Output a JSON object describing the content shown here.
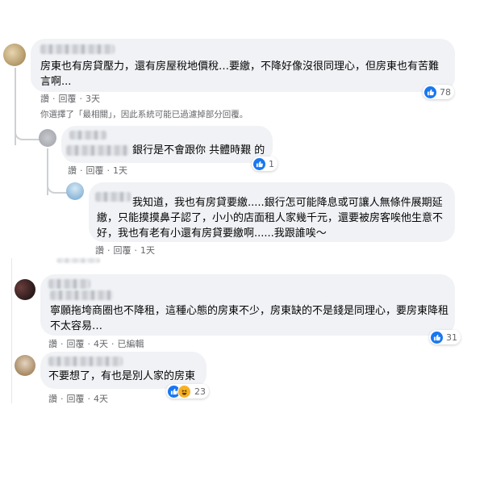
{
  "comments": [
    {
      "text": "房東也有房貸壓力，還有房屋稅地價稅…要繳，不降好像沒很同理心，但房東也有苦難言啊...",
      "actions": {
        "like": "讚",
        "reply": "回覆",
        "time": "3天"
      },
      "reaction_count": "78"
    },
    {
      "filter_note": "你選擇了「最相關」，因此系統可能已過濾掉部分回覆。"
    },
    {
      "text": "銀行是不會跟你 共體時艱 的",
      "actions": {
        "like": "讚",
        "reply": "回覆",
        "time": "1天"
      },
      "reaction_count": "1"
    },
    {
      "text": "我知道，我也有房貸要繳.....銀行怎可能降息或可讓人無條件展期延繳，只能摸摸鼻子認了，小小的店面租人家幾千元，還要被房客唉他生意不好，我也有老有小還有房貸要繳啊......我跟誰唉～",
      "actions": {
        "like": "讚",
        "reply": "回覆",
        "time": "1天"
      }
    },
    {
      "text": "寧願拖垮商圈也不降租，這種心態的房東不少，房東缺的不是錢是同理心，要房東降租不太容易…",
      "actions": {
        "like": "讚",
        "reply": "回覆",
        "time": "4天",
        "edited": "已編輯"
      },
      "reaction_count": "31"
    },
    {
      "text": "不要想了，有也是別人家的房東",
      "actions": {
        "like": "讚",
        "reply": "回覆",
        "time": "4天"
      },
      "reaction_count": "23"
    }
  ],
  "colors": {
    "like_blue": "#1877f2",
    "bubble_bg": "#f0f2f5",
    "meta_gray": "#65676b",
    "haha_yellow": "#f7b125"
  },
  "icons": [
    "like-icon",
    "haha-icon",
    "avatar"
  ]
}
